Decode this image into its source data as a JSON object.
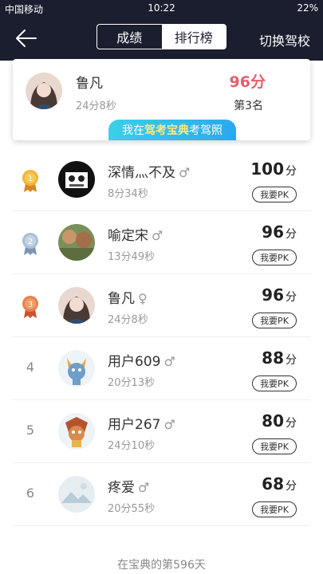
{
  "status": {
    "carrier": "中国移动",
    "time": "10:22",
    "battery": "22%"
  },
  "nav": {
    "tab_score": "成绩",
    "tab_rank": "排行榜",
    "switch_school": "切换驾校"
  },
  "me": {
    "name": "鲁凡",
    "time": "24分8秒",
    "score": "96分",
    "rank": "第3名",
    "banner_prefix": "我在",
    "banner_highlight": "驾考宝典",
    "banner_suffix": "考驾照"
  },
  "pk_label": "我要PK",
  "score_unit": "分",
  "rows": [
    {
      "rank": "1",
      "name": "深情灬不及",
      "gender": "♂",
      "time": "8分34秒",
      "score": "100"
    },
    {
      "rank": "2",
      "name": "喻定宋",
      "gender": "♂",
      "time": "13分49秒",
      "score": "96"
    },
    {
      "rank": "3",
      "name": "鲁凡",
      "gender": "♀",
      "time": "24分8秒",
      "score": "96"
    },
    {
      "rank": "4",
      "name": "用户609",
      "gender": "♂",
      "time": "20分13秒",
      "score": "88"
    },
    {
      "rank": "5",
      "name": "用户267",
      "gender": "♂",
      "time": "24分10秒",
      "score": "80"
    },
    {
      "rank": "6",
      "name": "疼爱",
      "gender": "♂",
      "time": "20分55秒",
      "score": "68"
    }
  ],
  "footer": "在宝典的第596天",
  "colors": {
    "header_bg": "#1b1e2e",
    "score_highlight": "#e5606a",
    "banner_start": "#3ad1e6",
    "banner_end": "#2aa8f0"
  }
}
